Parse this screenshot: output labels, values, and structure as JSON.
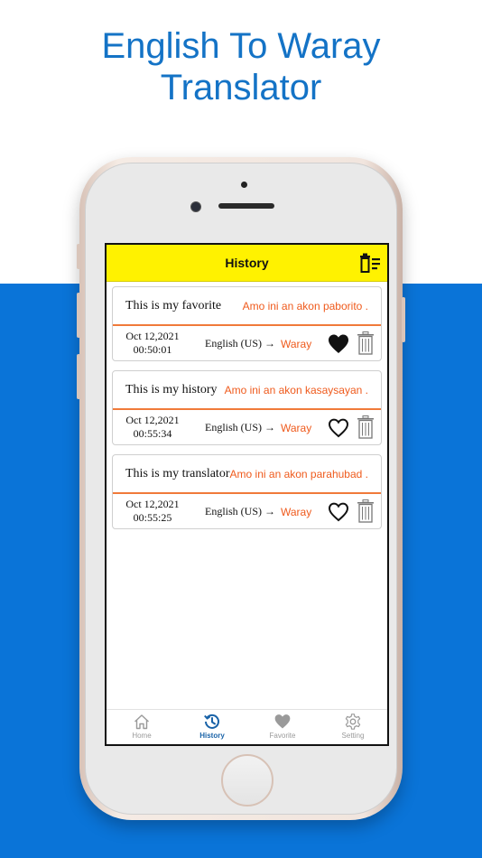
{
  "headline": {
    "line1": "English To Waray",
    "line2": "Translator"
  },
  "app": {
    "title": "History"
  },
  "history": [
    {
      "source": "This is my favorite",
      "translation": "Amo ini an akon paborito .",
      "date": "Oct 12,2021",
      "time": "00:50:01",
      "from_lang": "English (US) →",
      "to_lang": "Waray",
      "favorite": true
    },
    {
      "source": "This is my history",
      "translation": "Amo ini an akon kasaysayan .",
      "date": "Oct 12,2021",
      "time": "00:55:34",
      "from_lang": "English (US) →",
      "to_lang": "Waray",
      "favorite": false
    },
    {
      "source": "This is my translator",
      "translation": "Amo ini an akon parahubad .",
      "date": "Oct 12,2021",
      "time": "00:55:25",
      "from_lang": "English (US) →",
      "to_lang": "Waray",
      "favorite": false
    }
  ],
  "tabs": [
    {
      "label": "Home",
      "icon": "home-icon",
      "active": false
    },
    {
      "label": "History",
      "icon": "history-icon",
      "active": true
    },
    {
      "label": "Favorite",
      "icon": "heart-icon",
      "active": false
    },
    {
      "label": "Setting",
      "icon": "gear-icon",
      "active": false
    }
  ],
  "colors": {
    "background_band": "#0a74d8",
    "headline": "#1473c6",
    "header_bar": "#fff200",
    "translation_text": "#ef5a1c",
    "divider": "#f07a3a",
    "tab_active": "#1a63a8",
    "tab_inactive": "#9a9a9a"
  }
}
